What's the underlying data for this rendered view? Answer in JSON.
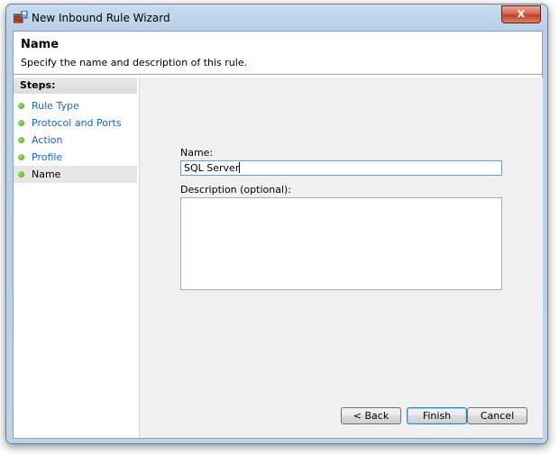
{
  "window": {
    "title": "New Inbound Rule Wizard",
    "close_glyph": "x",
    "icon": "firewall-wizard-icon"
  },
  "header": {
    "title": "Name",
    "subtitle": "Specify the name and description of this rule."
  },
  "steps": {
    "title": "Steps:",
    "items": [
      {
        "label": "Rule Type",
        "current": false
      },
      {
        "label": "Protocol and Ports",
        "current": false
      },
      {
        "label": "Action",
        "current": false
      },
      {
        "label": "Profile",
        "current": false
      },
      {
        "label": "Name",
        "current": true
      }
    ]
  },
  "form": {
    "name_label": "Name:",
    "name_value": "SQL Server",
    "description_label": "Description (optional):",
    "description_value": ""
  },
  "buttons": {
    "back": "< Back",
    "finish": "Finish",
    "cancel": "Cancel"
  },
  "colors": {
    "link": "#1a64c6",
    "bullet": "#3f9a1c",
    "close": "#c2412a"
  }
}
